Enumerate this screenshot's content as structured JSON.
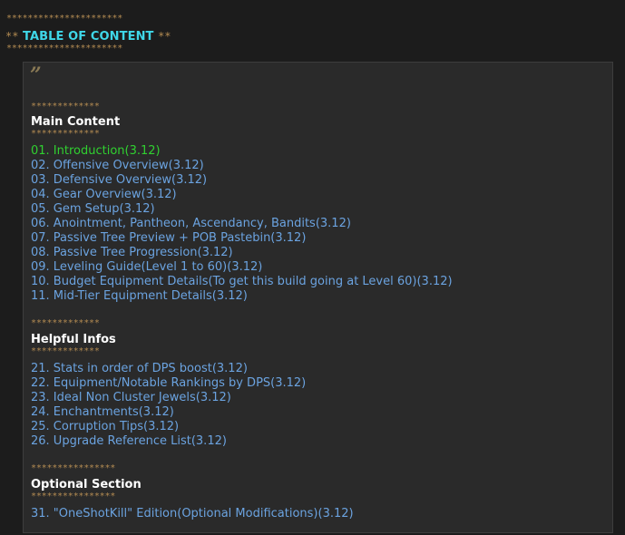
{
  "header": {
    "stars_top": "**********************",
    "deco_left": "**",
    "title": "TABLE OF CONTENT",
    "deco_right": "**",
    "stars_bottom": "**********************"
  },
  "quote": {
    "mark": "”"
  },
  "main_content": {
    "stars_top": "*************",
    "title": "Main Content",
    "stars_bottom": "*************",
    "items": [
      {
        "label": "01. Introduction(3.12)",
        "active": true
      },
      {
        "label": "02. Offensive Overview(3.12)"
      },
      {
        "label": "03. Defensive Overview(3.12)"
      },
      {
        "label": "04. Gear Overview(3.12)"
      },
      {
        "label": "05. Gem Setup(3.12)"
      },
      {
        "label": "06. Anointment, Pantheon, Ascendancy, Bandits(3.12)"
      },
      {
        "label": "07. Passive Tree Preview + POB Pastebin(3.12)"
      },
      {
        "label": "08. Passive Tree Progression(3.12)"
      },
      {
        "label": "09. Leveling Guide(Level 1 to 60)(3.12)"
      },
      {
        "label": "10. Budget Equipment Details(To get this build going at Level 60)(3.12)"
      },
      {
        "label": "11. Mid-Tier Equipment Details(3.12)"
      }
    ]
  },
  "helpful_infos": {
    "stars_top": "*************",
    "title": "Helpful Infos",
    "stars_bottom": "*************",
    "items": [
      {
        "label": "21. Stats in order of DPS boost(3.12)"
      },
      {
        "label": "22. Equipment/Notable Rankings by DPS(3.12)"
      },
      {
        "label": "23. Ideal Non Cluster Jewels(3.12)"
      },
      {
        "label": "24. Enchantments(3.12)"
      },
      {
        "label": "25. Corruption Tips(3.12)"
      },
      {
        "label": "26. Upgrade Reference List(3.12)"
      }
    ]
  },
  "optional_section": {
    "stars_top": "****************",
    "title": "Optional Section",
    "stars_bottom": "****************",
    "items": [
      {
        "label": "31. \"OneShotKill\" Edition(Optional Modifications)(3.12)"
      }
    ]
  },
  "colors": {
    "link": "#6ba3e0",
    "active_link": "#30d030",
    "title_accent": "#3fd7e8",
    "stars": "#b38b52",
    "background": "#1c1c1c",
    "box": "#2a2a2a"
  }
}
